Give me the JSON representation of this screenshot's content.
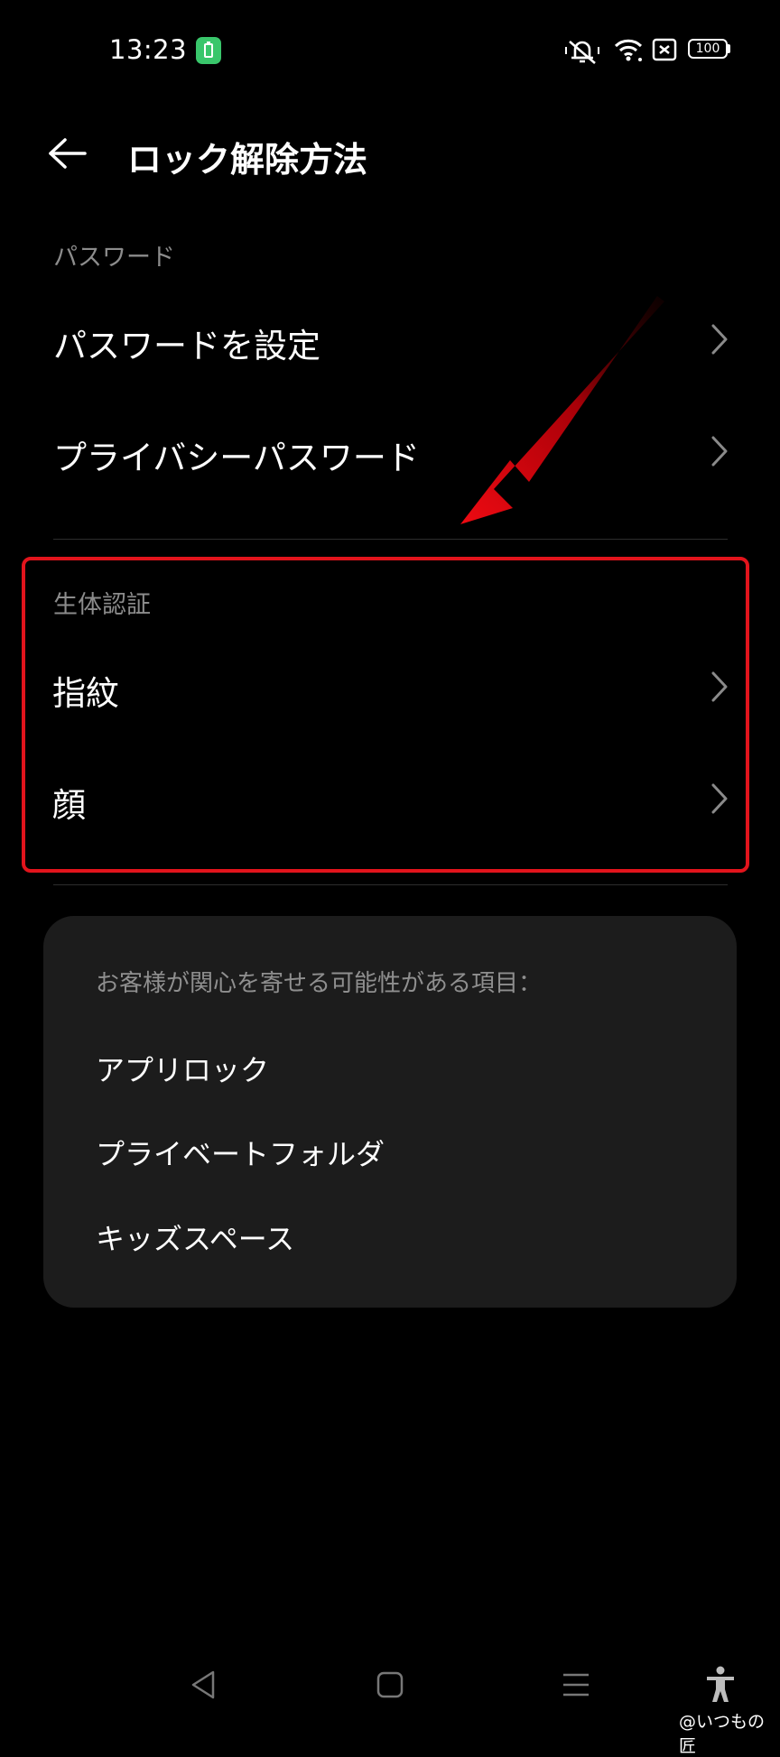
{
  "status_bar": {
    "time": "13:23",
    "battery_level": "100",
    "icons": [
      "battery-saver-icon",
      "mute-icon",
      "wifi-icon",
      "no-sim-icon",
      "battery-icon"
    ]
  },
  "header": {
    "title": "ロック解除方法",
    "back_icon": "back-arrow-icon"
  },
  "password_section": {
    "header": "パスワード",
    "items": [
      {
        "label": "パスワードを設定"
      },
      {
        "label": "プライバシーパスワード"
      }
    ]
  },
  "biometric_section": {
    "header": "生体認証",
    "items": [
      {
        "label": "指紋"
      },
      {
        "label": "顔"
      }
    ]
  },
  "suggestions": {
    "heading": "お客様が関心を寄せる可能性がある項目：",
    "items": [
      {
        "label": "アプリロック"
      },
      {
        "label": "プライベートフォルダ"
      },
      {
        "label": "キッズスペース"
      }
    ]
  },
  "nav_bar": {
    "icons": [
      "back-triangle-icon",
      "home-square-icon",
      "recents-menu-icon",
      "accessibility-icon"
    ]
  },
  "annotation": {
    "highlight_color": "#e2141c",
    "watermark": "@いつもの匠"
  }
}
